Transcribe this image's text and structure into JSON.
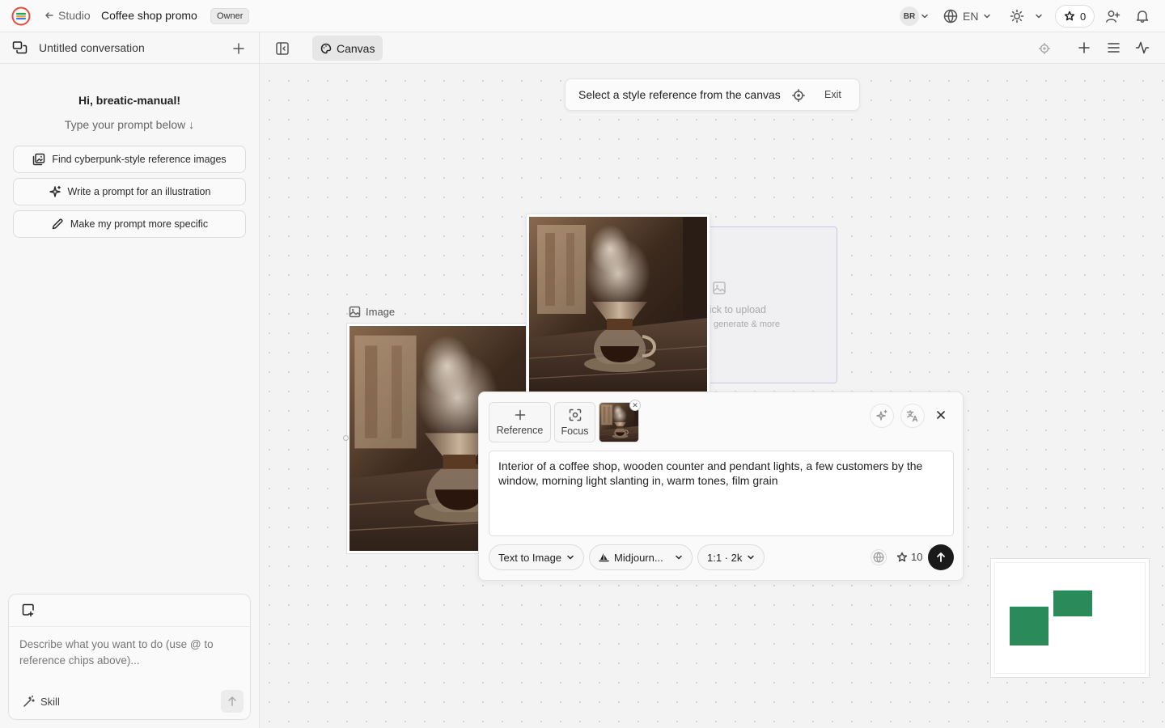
{
  "topbar": {
    "back_label": "Studio",
    "project_title": "Coffee shop promo",
    "role_badge": "Owner",
    "avatar_initials": "BR",
    "language": "EN",
    "credits": "0"
  },
  "sidebar": {
    "conversation_title": "Untitled conversation",
    "greeting": "Hi, breatic-manual!",
    "greeting_sub": "Type your prompt below ↓",
    "suggestions": [
      {
        "label": "Find cyberpunk-style reference images",
        "icon": "image-search-icon"
      },
      {
        "label": "Write a prompt for an illustration",
        "icon": "sparkles-icon"
      },
      {
        "label": "Make my prompt more specific",
        "icon": "pencil-icon"
      }
    ],
    "composer": {
      "placeholder": "Describe what you want to do (use @ to reference chips above)...",
      "skill_label": "Skill"
    }
  },
  "canvas": {
    "tab_label": "Canvas",
    "hint": {
      "text": "Select a style reference from the canvas",
      "exit_label": "Exit"
    },
    "image_node_label": "Image",
    "upload_node": {
      "line1": "lick to upload",
      "line2": "generate & more"
    }
  },
  "generator": {
    "reference_label": "Reference",
    "focus_label": "Focus",
    "prompt": "Interior of a coffee shop, wooden counter and pendant lights, a few customers by the window, morning light slanting in, warm tones, film grain",
    "mode": "Text to Image",
    "model": "Midjourn...",
    "ratio": "1:1 · 2k",
    "cost": "10"
  },
  "colors": {
    "accent_green": "#2b8a5a",
    "logo_red": "#e64a3b",
    "logo_green": "#22a35a"
  }
}
